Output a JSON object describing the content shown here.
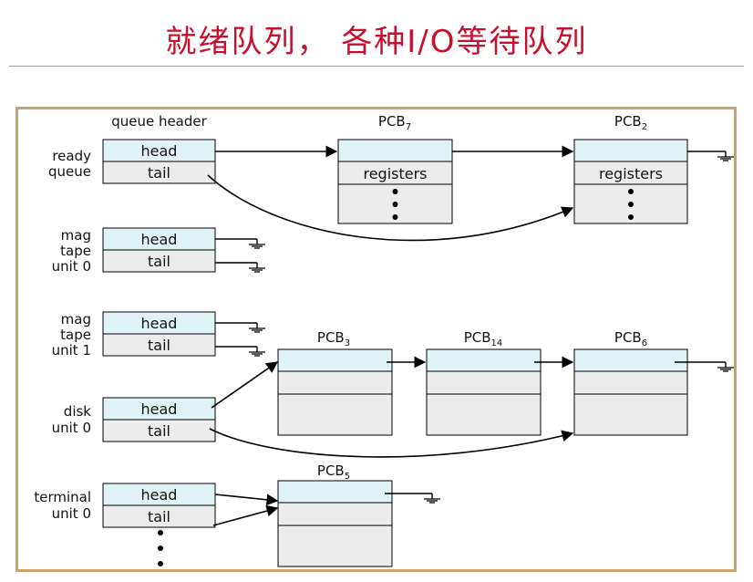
{
  "title": "就绪队列， 各种I/O等待队列",
  "column_header": "queue header",
  "cell_labels": {
    "head": "head",
    "tail": "tail",
    "registers": "registers"
  },
  "queues": [
    {
      "id": "ready",
      "lines": [
        "ready",
        "queue"
      ]
    },
    {
      "id": "mag0",
      "lines": [
        "mag",
        "tape",
        "unit 0"
      ]
    },
    {
      "id": "mag1",
      "lines": [
        "mag",
        "tape",
        "unit 1"
      ]
    },
    {
      "id": "disk",
      "lines": [
        "disk",
        "unit 0"
      ]
    },
    {
      "id": "terminal",
      "lines": [
        "terminal",
        "unit 0"
      ]
    }
  ],
  "pcbs": [
    {
      "id": "pcb7",
      "base": "PCB",
      "sub": "7"
    },
    {
      "id": "pcb2",
      "base": "PCB",
      "sub": "2"
    },
    {
      "id": "pcb3",
      "base": "PCB",
      "sub": "3"
    },
    {
      "id": "pcb14",
      "base": "PCB",
      "sub": "14"
    },
    {
      "id": "pcb6",
      "base": "PCB",
      "sub": "6"
    },
    {
      "id": "pcb5",
      "base": "PCB",
      "sub": "5"
    }
  ],
  "colors": {
    "title": "#c8102e",
    "head_fill": "#dff3f7",
    "cell_fill": "#ececec",
    "frame": "#c9a36a"
  }
}
